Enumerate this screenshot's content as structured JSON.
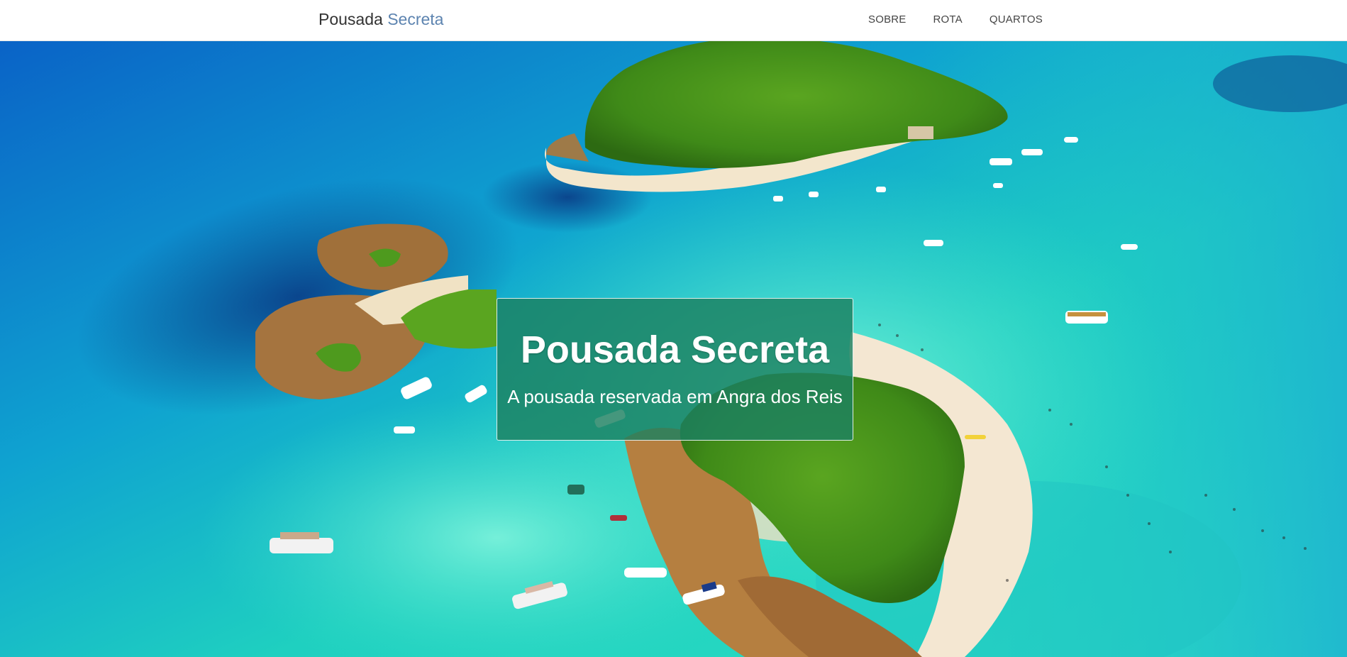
{
  "navbar": {
    "brand_main": "Pousada",
    "brand_accent": "Secreta",
    "links": [
      {
        "label": "SOBRE"
      },
      {
        "label": "ROTA"
      },
      {
        "label": "QUARTOS"
      }
    ]
  },
  "hero": {
    "image_description_icon": "aerial-island-photo",
    "title": "Pousada Secreta",
    "subtitle": "A pousada reservada em Angra dos Reis"
  },
  "colors": {
    "brand_accent": "#5d84b0",
    "caption_bg": "#1c8060",
    "sea": "#17c4c4",
    "deep_sea": "#0d5fb8"
  }
}
